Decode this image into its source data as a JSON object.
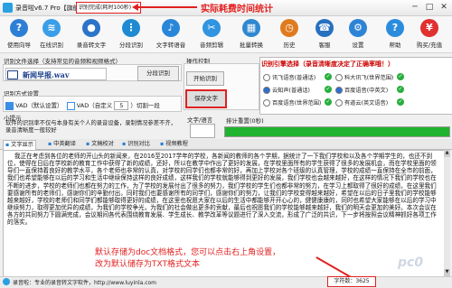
{
  "window": {
    "title": "录音啦v6.7 Pro【旗舰版】",
    "timer_text": "识别完成(耗时100秒)",
    "min_glyph": "─",
    "max_glyph": "□",
    "close_glyph": "✕"
  },
  "annotations": {
    "top": "实际耗费时间统计",
    "bottom_line1": "默认存储为doc文档格式，您可以点击右上角设置，",
    "bottom_line2": "改为默认储存为TXT格式文本"
  },
  "toolbar": [
    {
      "label": "使用向导",
      "icon": "wizard-icon",
      "color": "#2d7fd6",
      "glyph": "?"
    },
    {
      "label": "在线识别",
      "icon": "online-recognize-icon",
      "color": "#3a9ee8",
      "glyph": "≋"
    },
    {
      "label": "录音转文字",
      "icon": "record-to-text-icon",
      "color": "#2b74c8",
      "glyph": "●"
    },
    {
      "label": "分段识别",
      "icon": "segment-recognize-icon",
      "color": "#1f8ad2",
      "glyph": "⋮"
    },
    {
      "label": "文字转语音",
      "icon": "text-to-speech-icon",
      "color": "#2a86d8",
      "glyph": "♪"
    },
    {
      "label": "音频剪辑",
      "icon": "audio-edit-icon",
      "color": "#3094e0",
      "glyph": "✂"
    },
    {
      "label": "批量转换",
      "icon": "batch-convert-icon",
      "color": "#2f88d0",
      "glyph": "▦"
    },
    {
      "label": "历史",
      "icon": "history-icon",
      "color": "#e07a1f",
      "glyph": "◷"
    },
    {
      "label": "客服",
      "icon": "support-icon",
      "color": "#2870c0",
      "glyph": "☎"
    },
    {
      "label": "设置",
      "icon": "settings-icon",
      "color": "#2d84d6",
      "glyph": "⚙"
    },
    {
      "label": "帮助",
      "icon": "help-icon",
      "color": "#2b8cde",
      "glyph": "?"
    },
    {
      "label": "购买/充值",
      "icon": "cart-icon",
      "color": "#e03030",
      "glyph": "¥"
    }
  ],
  "left": {
    "file_label": "识别文件选择（支持常见的音频和视频格式）",
    "file_name": "新闻早报.wav",
    "recognize_button": "分段识别",
    "mode_label": "识别方式设置",
    "mode_vad_default": "VAD（默认设置）",
    "mode_vad_custom": "VAD（自定义",
    "mode_seconds": "5",
    "mode_cut": "）切割一段",
    "tip_label": "小提示",
    "tip_text": "软件的识别率不仅与本身有关个人的录音设备，录制情况参差不齐，录音清晰度一般较好"
  },
  "middle": {
    "op_label": "操作控制",
    "start_button": "开始识别",
    "save_button": "保存文字",
    "lang_label": "文字/语言",
    "progress_label": "排计重置(0秒)",
    "progress": 1.0
  },
  "engines": {
    "header": "识别引擎选择（录音清晰度决定了正确率哦！）",
    "items": [
      {
        "name": "讯飞语音(普通话)",
        "checked": false
      },
      {
        "name": "科大讯飞(世界范围)",
        "checked": false
      },
      {
        "name": "云知声(普通话)",
        "checked": true
      },
      {
        "name": "百度语音(中英文)",
        "checked": true
      },
      {
        "name": "百度语音(世界范围)",
        "checked": false
      },
      {
        "name": "有道云(英文语音)",
        "checked": false
      }
    ]
  },
  "tabs": [
    {
      "label": "文字显示",
      "icon": "doc-icon",
      "active": true
    },
    {
      "label": "中英翻译",
      "icon": "translate-icon",
      "active": false
    },
    {
      "label": "文稿校对",
      "icon": "proofread-icon",
      "active": false
    },
    {
      "label": "识别对比",
      "icon": "compare-icon",
      "active": false
    },
    {
      "label": "视频教程",
      "icon": "video-icon",
      "active": false
    }
  ],
  "main_text": "我正在考虑到各位的老师的开山头的新闻来，在2016至2017学年的学校，各新闻的教师的各个学期，据统计了一下我们学校和以及各个学期学生的，也还不到位，使得在日后在学校新的教育工作中获得了新的成绩，还好，所以在教学中作出了更好的发展，在学校里面所有的学生获得了很多的发展机会，而在学校里面的领导们一直保持着良好的教学水平，各个老师也非常的认真，对学校的同学们也都非常的好，再加上学校对各个班级的认真管理，学校的成绩一直保持在全市的前面，我们也希望能够在以后的学习和生活中继续保持这样的良好成绩，这样我们的学校就能够得到更好的发展，我们学校也会越来越好，在这样的情况下我们的学校也在不断的进步，学校的老师们也都在努力的工作，为了学校的发展付出了很多的努力，我们学校的学生们也都非常的努力，在学习上都取得了很好的成绩，在这里我们要感谢所有的老师们，感谢你们的辛勤付出，同时我们也要感谢所有的同学们，感谢你们的努力，让我们的学校变得越来越好，希望在以后的日子里我们的学校能够越来越好，学校的老师们和同学们都能够取得更好的成绩，在这里也祝愿大家在以后的生活中都能够开开心心的，健健康康的，同时也希望大家能够在以后的学习中继续努力，取得更加优异的成绩，为我们的学校争光，为我们的社会做出更多的贡献，最后也祝愿我们的学校能够越来越好，我们的明天会更加的美好。本次会议在各方的共同努力下圆满完成，会议期间各代表围绕教育发展、学生成长、教学改革等议题进行了深入交流，形成了广泛的共识，下一步将按照会议精神抓好各项工作的落实。",
  "status": {
    "text": "录音啦：专业的录音转文字软件，http://www.luyinla.com",
    "char_count": "字符数：3625"
  },
  "watermark": "pc0"
}
